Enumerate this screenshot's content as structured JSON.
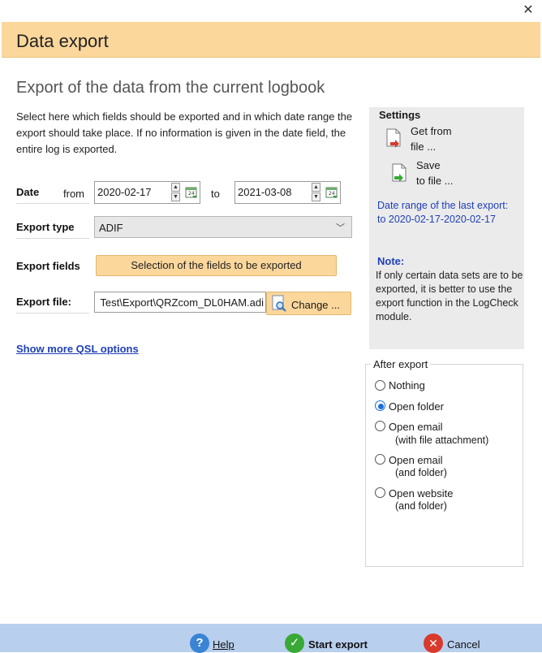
{
  "window": {
    "close_glyph": "✕",
    "header_title": "Data export",
    "subtitle": "Export of the data from the current logbook",
    "intro": "Select here which fields should be exported and in which date range the export should take place. If no information is given in the date field, the entire log is exported."
  },
  "form": {
    "date_label": "Date",
    "from_label": "from",
    "from_value": "2020-02-17",
    "to_label": "to",
    "to_value": "2021-03-08",
    "export_type_label": "Export type",
    "export_type_value": "ADIF",
    "export_fields_label": "Export fields",
    "export_fields_button": "Selection of the fields to be exported",
    "export_file_label": "Export file:",
    "export_file_value": "Test\\Export\\QRZcom_DL0HAM.adi",
    "change_button": "Change ...",
    "qsl_link": "Show more QSL options"
  },
  "settings": {
    "title": "Settings",
    "get_line1": "Get from",
    "get_line2": "file ...",
    "save_line1": "Save",
    "save_line2": "to file ...",
    "range_text": "Date range of the last export: to 2020-02-17-2020-02-17",
    "note_title": "Note:",
    "note_text": "If only certain data sets are to be exported, it is better to use the export function in the LogCheck module."
  },
  "after_export": {
    "title": "After export",
    "options": [
      {
        "label": "Nothing",
        "sub": "",
        "checked": false
      },
      {
        "label": "Open folder",
        "sub": "",
        "checked": true
      },
      {
        "label": "Open email",
        "sub": "(with file attachment)",
        "checked": false
      },
      {
        "label": "Open email",
        "sub": "(and folder)",
        "checked": false
      },
      {
        "label": "Open website",
        "sub": "(and folder)",
        "checked": false
      }
    ]
  },
  "footer": {
    "help": "Help",
    "start_export": "Start export",
    "cancel": "Cancel"
  },
  "icons": {
    "help": "question-icon",
    "start": "checkmark-icon",
    "cancel": "close-icon"
  }
}
